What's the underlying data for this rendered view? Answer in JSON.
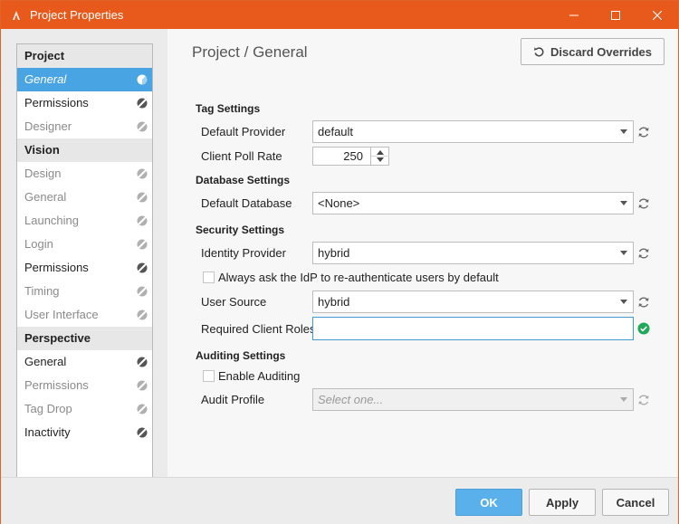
{
  "window": {
    "title": "Project Properties"
  },
  "sidebar": {
    "sections": [
      {
        "header": "Project",
        "items": [
          {
            "label": "General",
            "state": "selected"
          },
          {
            "label": "Permissions",
            "state": "normal"
          },
          {
            "label": "Designer",
            "state": "dim"
          }
        ]
      },
      {
        "header": "Vision",
        "items": [
          {
            "label": "Design",
            "state": "dim"
          },
          {
            "label": "General",
            "state": "dim"
          },
          {
            "label": "Launching",
            "state": "dim"
          },
          {
            "label": "Login",
            "state": "dim"
          },
          {
            "label": "Permissions",
            "state": "normal"
          },
          {
            "label": "Timing",
            "state": "dim"
          },
          {
            "label": "User Interface",
            "state": "dim"
          }
        ]
      },
      {
        "header": "Perspective",
        "items": [
          {
            "label": "General",
            "state": "normal"
          },
          {
            "label": "Permissions",
            "state": "dim"
          },
          {
            "label": "Tag Drop",
            "state": "dim"
          },
          {
            "label": "Inactivity",
            "state": "normal"
          }
        ]
      }
    ]
  },
  "main": {
    "title": "Project / General",
    "discard_label": "Discard Overrides",
    "tag_settings": {
      "header": "Tag Settings",
      "default_provider_label": "Default Provider",
      "default_provider_value": "default",
      "poll_rate_label": "Client Poll Rate",
      "poll_rate_value": "250"
    },
    "database_settings": {
      "header": "Database Settings",
      "default_db_label": "Default Database",
      "default_db_value": "<None>"
    },
    "security_settings": {
      "header": "Security Settings",
      "idp_label": "Identity Provider",
      "idp_value": "hybrid",
      "reauth_label": "Always ask the IdP to re-authenticate users by default",
      "user_source_label": "User Source",
      "user_source_value": "hybrid",
      "roles_label": "Required Client Roles",
      "roles_value": ""
    },
    "auditing_settings": {
      "header": "Auditing Settings",
      "enable_label": "Enable Auditing",
      "audit_profile_label": "Audit Profile",
      "audit_profile_placeholder": "Select one..."
    }
  },
  "footer": {
    "ok": "OK",
    "apply": "Apply",
    "cancel": "Cancel"
  },
  "colors": {
    "titlebar": "#e85a1b",
    "selection": "#48a4e2",
    "primary_button": "#5ab0ea",
    "valid": "#1fa85a"
  }
}
